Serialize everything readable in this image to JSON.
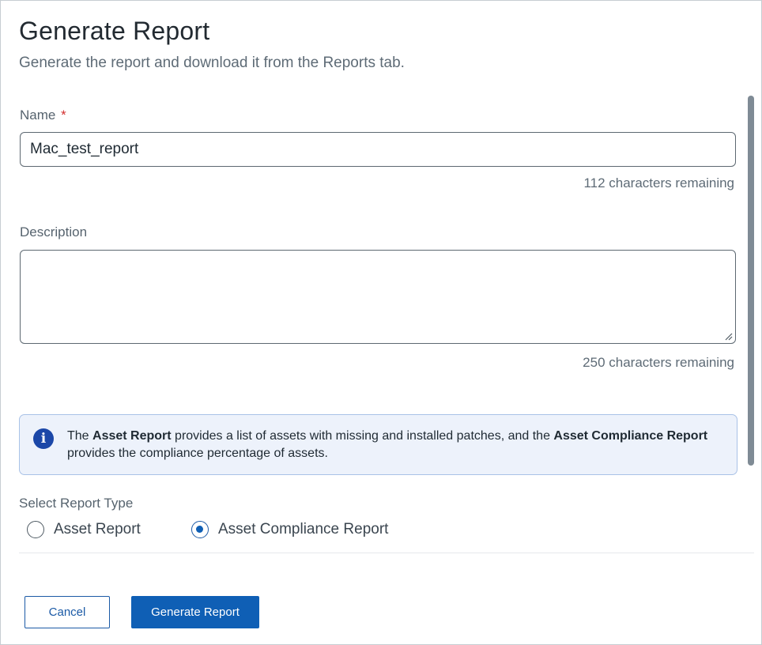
{
  "dialog": {
    "title": "Generate Report",
    "subtitle": "Generate the report and download it from the Reports tab."
  },
  "name_field": {
    "label": "Name",
    "required_marker": "*",
    "value": "Mac_test_report",
    "counter": "112 characters remaining"
  },
  "description_field": {
    "label": "Description",
    "value": "",
    "counter": "250 characters remaining"
  },
  "info": {
    "icon": "info-icon",
    "text_1": "The ",
    "bold_1": "Asset Report",
    "text_2": " provides a list of assets with missing and installed patches, and the ",
    "bold_2": "Asset Compliance Report",
    "text_3": " provides the compliance percentage of assets."
  },
  "report_type": {
    "label": "Select Report Type",
    "options": [
      {
        "label": "Asset Report",
        "selected": false
      },
      {
        "label": "Asset Compliance Report",
        "selected": true
      }
    ]
  },
  "buttons": {
    "cancel": "Cancel",
    "generate": "Generate Report"
  },
  "colors": {
    "primary": "#0f5fb5",
    "required": "#d32f2f",
    "info_background": "#edf2fb",
    "info_icon": "#1b47a8"
  }
}
